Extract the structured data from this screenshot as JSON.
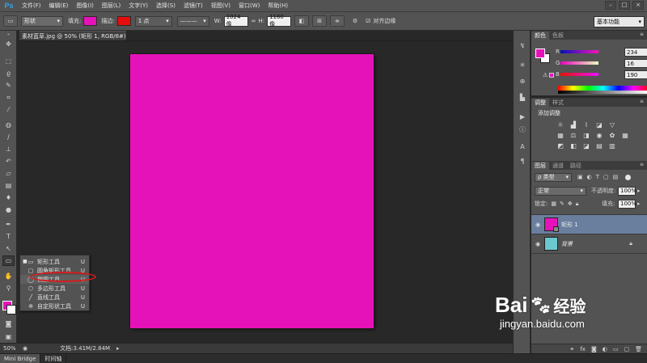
{
  "menubar": {
    "logo": "Ps",
    "items": [
      "文件(F)",
      "编辑(E)",
      "图像(I)",
      "图层(L)",
      "文字(Y)",
      "选择(S)",
      "滤镜(T)",
      "视图(V)",
      "窗口(W)",
      "帮助(H)"
    ],
    "window_controls": [
      "–",
      "□",
      "×"
    ]
  },
  "options_bar": {
    "mode": "形状",
    "fill_label": "填充:",
    "fill_color": "#e612b9",
    "stroke_label": "描边:",
    "stroke_color": "#e80c0c",
    "stroke_width": "1 点",
    "w_label": "W:",
    "w_value": "1024 像",
    "link_icon": "∞",
    "h_label": "H:",
    "h_value": "1160 像",
    "align_edges_label": "对齐边缘",
    "align_edges_checked": true,
    "workspace": "基本功能"
  },
  "document": {
    "tab_title": "素材蓝草.jpg @ 50% (矩形 1, RGB/8#) *",
    "close": "×",
    "canvas_color": "#e612b9"
  },
  "toolbar": {
    "fg_color": "#e612b9",
    "bg_color": "#ffffff"
  },
  "flyout": {
    "items": [
      {
        "label": "矩形工具",
        "key": "U",
        "bullet": "■"
      },
      {
        "label": "圆角矩形工具",
        "key": "U",
        "bullet": ""
      },
      {
        "label": "椭圆工具",
        "key": "U",
        "bullet": ""
      },
      {
        "label": "多边形工具",
        "key": "U",
        "bullet": ""
      },
      {
        "label": "直线工具",
        "key": "U",
        "bullet": ""
      },
      {
        "label": "自定形状工具",
        "key": "U",
        "bullet": ""
      }
    ]
  },
  "status": {
    "zoom": "50%",
    "doc_info": "文档:3.41M/2.84M"
  },
  "bottom_tabs": [
    "Mini Bridge",
    "时间轴"
  ],
  "color_panel": {
    "tabs": [
      "颜色",
      "色板"
    ],
    "r_label": "R",
    "g_label": "G",
    "b_label": "B",
    "r": "234",
    "g": "16",
    "b": "190",
    "fg_color": "#e612b9",
    "bg_color": "#ffffff"
  },
  "adjust_panel": {
    "tabs": [
      "调整",
      "样式"
    ],
    "title": "添加调整"
  },
  "layers_panel": {
    "tabs": [
      "图层",
      "通道",
      "路径"
    ],
    "kind": "ρ 类型",
    "blend_mode": "正常",
    "opacity_label": "不透明度:",
    "opacity": "100%",
    "lock_label": "锁定:",
    "fill_label": "填充:",
    "fill": "100%",
    "layers": [
      {
        "name": "矩形 1",
        "selected": true
      },
      {
        "name": "背景",
        "selected": false
      }
    ]
  },
  "watermark": {
    "brand_text": "Bai",
    "brand_suffix": "经验",
    "url": "jingyan.baidu.com"
  }
}
